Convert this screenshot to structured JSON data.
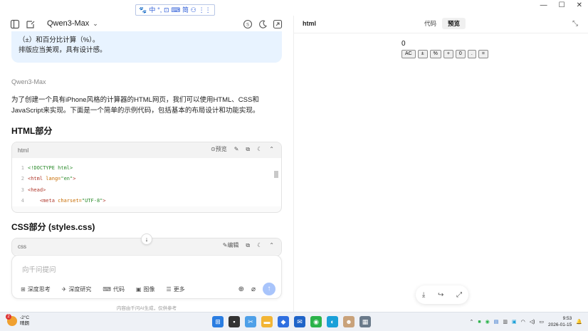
{
  "window": {
    "minimize": "—",
    "maximize": "☐",
    "close": "✕"
  },
  "ime": {
    "items": [
      "🐾",
      "中",
      "°,",
      "⊡",
      "⌨",
      "简",
      "⚇",
      "⋮⋮"
    ]
  },
  "header": {
    "model_name": "Qwen3-Max",
    "chevron": "⌄"
  },
  "user_message": {
    "lines": [
      "（±）和百分比计算（%）。",
      "排版应当美观，具有设计感。"
    ]
  },
  "assistant": {
    "label": "Qwen3-Max",
    "intro": "为了创建一个具有iPhone风格的计算器的HTML网页，我们可以使用HTML、CSS和JavaScript来实现。下面是一个简单的示例代码，包括基本的布局设计和功能实现。",
    "section1": "HTML部分",
    "section2": "CSS部分 (styles.css)"
  },
  "code_html": {
    "lang": "html",
    "preview_label": "预览",
    "lines": [
      {
        "n": "1",
        "parts": [
          {
            "c": "dt",
            "t": "<!DOCTYPE html>"
          }
        ]
      },
      {
        "n": "2",
        "parts": [
          {
            "c": "tag",
            "t": "<html "
          },
          {
            "c": "attr",
            "t": "lang="
          },
          {
            "c": "val",
            "t": "\"en\""
          },
          {
            "c": "tag",
            "t": ">"
          }
        ]
      },
      {
        "n": "3",
        "parts": [
          {
            "c": "tag",
            "t": "<head>"
          }
        ]
      },
      {
        "n": "4",
        "parts": [
          {
            "c": "",
            "t": "    "
          },
          {
            "c": "tag",
            "t": "<meta "
          },
          {
            "c": "attr",
            "t": "charset="
          },
          {
            "c": "val",
            "t": "\"UTF-8\""
          },
          {
            "c": "tag",
            "t": ">"
          }
        ]
      }
    ]
  },
  "code_css": {
    "lang": "css",
    "edit_label": "编辑"
  },
  "composer": {
    "placeholder": "向千问提问",
    "options": [
      {
        "icon": "⊞",
        "label": "深度思考"
      },
      {
        "icon": "✈",
        "label": "深度研究"
      },
      {
        "icon": "⌨",
        "label": "代码"
      },
      {
        "icon": "▣",
        "label": "图像"
      },
      {
        "icon": "☰",
        "label": "更多"
      }
    ],
    "disclaimer": "内容由千问AI生成，仅供参考"
  },
  "preview_pane": {
    "title": "html",
    "tabs": [
      "代码",
      "预览"
    ],
    "active_tab": "预览",
    "display": "0",
    "keys": [
      "AC",
      "±",
      "%",
      "+",
      "0",
      ".",
      "="
    ]
  },
  "taskbar": {
    "weather_temp": "-2°C",
    "weather_desc": "晴朗",
    "weather_badge": "2",
    "time": "9:53",
    "date": "2026-01-15"
  }
}
